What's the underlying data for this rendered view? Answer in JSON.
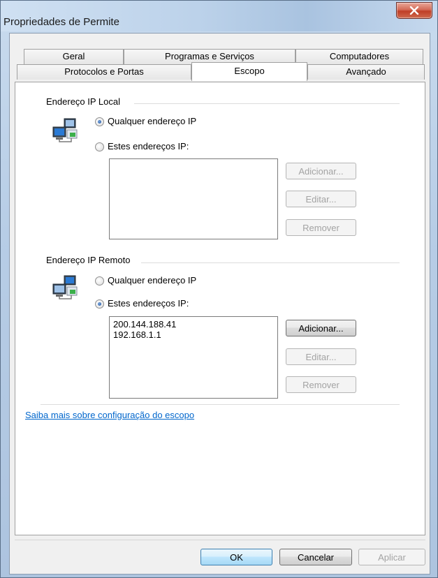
{
  "window": {
    "title": "Propriedades de Permite"
  },
  "tabs": {
    "row_back": [
      "Geral",
      "Programas e Serviços",
      "Computadores"
    ],
    "row_front": [
      "Protocolos e Portas",
      "Escopo",
      "Avançado"
    ],
    "active": "Escopo"
  },
  "local": {
    "group_label": "Endereço IP Local",
    "radio_any": "Qualquer endereço IP",
    "radio_these": "Estes endereços IP:",
    "selected": "any",
    "addresses": [],
    "add_label": "Adicionar...",
    "edit_label": "Editar...",
    "remove_label": "Remover",
    "add_enabled": false,
    "edit_enabled": false,
    "remove_enabled": false
  },
  "remote": {
    "group_label": "Endereço IP Remoto",
    "radio_any": "Qualquer endereço IP",
    "radio_these": "Estes endereços IP:",
    "selected": "these",
    "addresses": [
      "200.144.188.41",
      "192.168.1.1"
    ],
    "add_label": "Adicionar...",
    "edit_label": "Editar...",
    "remove_label": "Remover",
    "add_enabled": true,
    "edit_enabled": false,
    "remove_enabled": false
  },
  "help_link": "Saiba mais sobre configuração do escopo",
  "footer": {
    "ok_label": "OK",
    "cancel_label": "Cancelar",
    "apply_label": "Aplicar"
  },
  "icons": {
    "close": "close-icon",
    "network": "network-computers-icon"
  }
}
